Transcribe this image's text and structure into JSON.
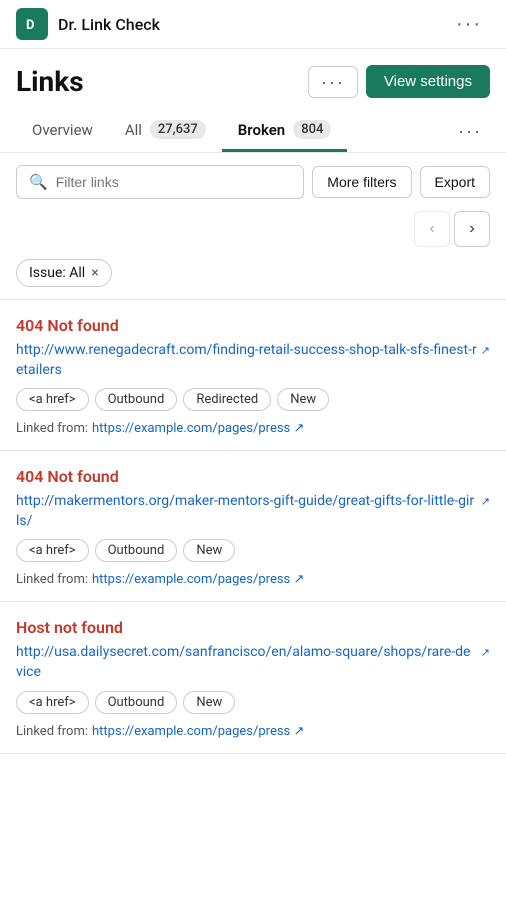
{
  "app": {
    "logo_text": "D",
    "title": "Dr. Link Check"
  },
  "header": {
    "page_title": "Links",
    "btn_more_label": "···",
    "btn_view_settings_label": "View settings"
  },
  "tabs": [
    {
      "id": "overview",
      "label": "Overview",
      "badge": null,
      "active": false
    },
    {
      "id": "all",
      "label": "All",
      "badge": "27,637",
      "active": false
    },
    {
      "id": "broken",
      "label": "Broken",
      "badge": "804",
      "active": true
    }
  ],
  "tabs_more_label": "···",
  "filter": {
    "search_placeholder": "Filter links",
    "more_filters_label": "More filters",
    "export_label": "Export"
  },
  "active_filter": {
    "label": "Issue: All",
    "close_icon": "×"
  },
  "pagination": {
    "prev_label": "‹",
    "next_label": "›"
  },
  "link_cards": [
    {
      "error": "404 Not found",
      "url": "http://www.renegadecraft.com/finding-retail-success-shop-talk-sfs-finest-retailers",
      "url_display": "http://www.renegadecraft.com/finding-retail-success-shop-talk-sfs-finest-retailers ↗",
      "tags": [
        "<a href>",
        "Outbound",
        "Redirected",
        "New"
      ],
      "linked_from_label": "Linked from:",
      "linked_from_url": "https://example.com/pages/press",
      "linked_from_url_display": "https://example.com/pages/press ↗"
    },
    {
      "error": "404 Not found",
      "url": "http://makermentors.org/maker-mentors-gift-guide/great-gifts-for-little-girls/",
      "url_display": "http://makermentors.org/maker-mentors-gift-guide/great-gifts-for-little-girls/ ↗",
      "tags": [
        "<a href>",
        "Outbound",
        "New"
      ],
      "linked_from_label": "Linked from:",
      "linked_from_url": "https://example.com/pages/press",
      "linked_from_url_display": "https://example.com/pages/press ↗"
    },
    {
      "error": "Host not found",
      "url": "http://usa.dailysecret.com/sanfrancisco/en/alamo-square/shops/rare-device",
      "url_display": "http://usa.dailysecret.com/sanfrancisco/en/alamo-square/shops/rare-device ↗",
      "tags": [
        "<a href>",
        "Outbound",
        "New"
      ],
      "linked_from_label": "Linked from:",
      "linked_from_url": "https://example.com/pages/press",
      "linked_from_url_display": "https://example.com/pages/press ↗"
    }
  ]
}
